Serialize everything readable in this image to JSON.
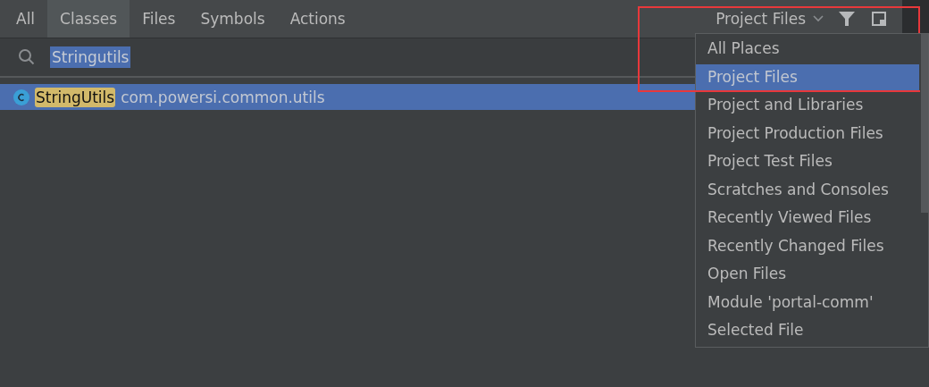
{
  "tabs": [
    {
      "label": "All",
      "selected": false
    },
    {
      "label": "Classes",
      "selected": true
    },
    {
      "label": "Files",
      "selected": false
    },
    {
      "label": "Symbols",
      "selected": false
    },
    {
      "label": "Actions",
      "selected": false
    }
  ],
  "scope": {
    "label": "Project Files"
  },
  "search": {
    "value": "Stringutils"
  },
  "results": [
    {
      "match": "StringUtils",
      "package": "com.powersi.common.utils",
      "selected": true
    }
  ],
  "scope_menu": {
    "items": [
      {
        "label": "All Places",
        "selected": false
      },
      {
        "label": "Project Files",
        "selected": true
      },
      {
        "label": "Project and Libraries",
        "selected": false
      },
      {
        "label": "Project Production Files",
        "selected": false
      },
      {
        "label": "Project Test Files",
        "selected": false
      },
      {
        "label": "Scratches and Consoles",
        "selected": false
      },
      {
        "label": "Recently Viewed Files",
        "selected": false
      },
      {
        "label": "Recently Changed Files",
        "selected": false
      },
      {
        "label": "Open Files",
        "selected": false
      },
      {
        "label": "Module 'portal-comm'",
        "selected": false
      },
      {
        "label": "Selected File",
        "selected": false
      }
    ]
  }
}
